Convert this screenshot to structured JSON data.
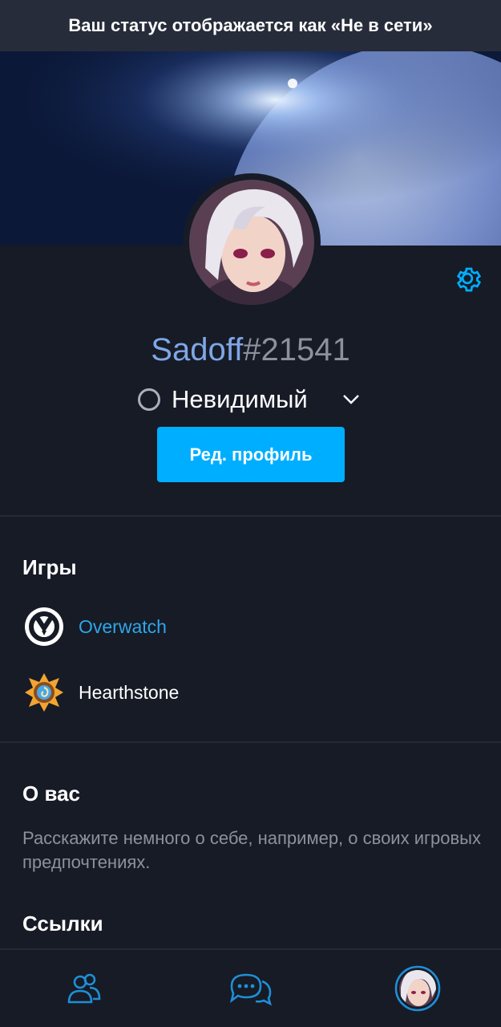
{
  "status_banner": {
    "text": "Ваш статус отображается как «Не в сети»"
  },
  "profile": {
    "name": "Sadoff",
    "tag": "#21541",
    "presence": "Невидимый",
    "edit_button": "Ред. профиль"
  },
  "games": {
    "title": "Игры",
    "items": [
      {
        "label": "Overwatch",
        "icon": "overwatch-logo-icon",
        "color": "#2fa6e8"
      },
      {
        "label": "Hearthstone",
        "icon": "hearthstone-logo-icon",
        "color": "#ffffff"
      }
    ]
  },
  "about": {
    "title": "О вас",
    "placeholder": "Расскажите немного о себе, например, о своих игровых предпочтениях."
  },
  "links": {
    "title": "Ссылки"
  },
  "nav": {
    "items": [
      {
        "icon": "friends-icon"
      },
      {
        "icon": "chat-icon"
      },
      {
        "icon": "profile-avatar-icon"
      }
    ]
  },
  "colors": {
    "accent": "#00aeff",
    "background": "#161b26",
    "banner": "#262c3a",
    "username": "#7fa6e6",
    "muted": "#8c919c"
  }
}
